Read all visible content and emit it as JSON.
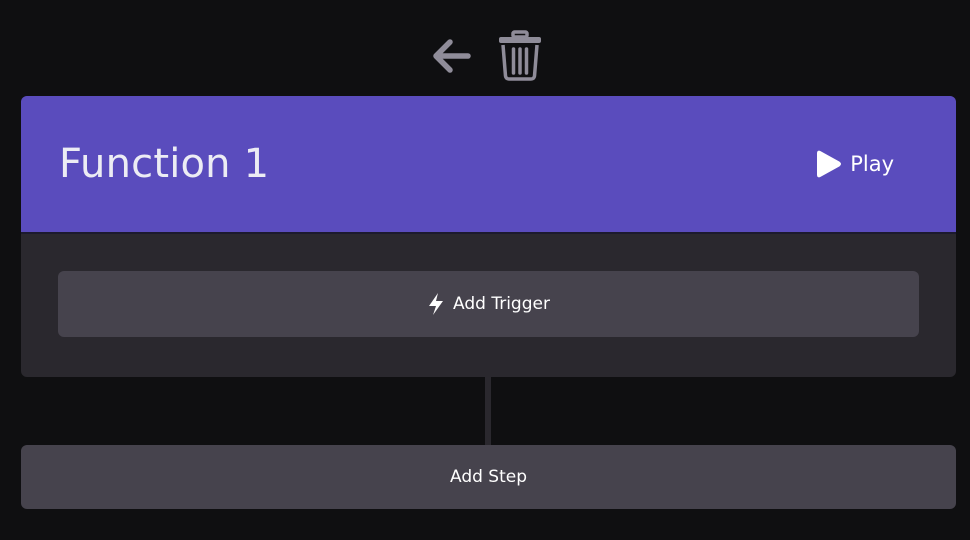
{
  "toolbar": {
    "back_icon": "arrow-left-icon",
    "delete_icon": "trash-icon"
  },
  "function_card": {
    "title": "Function 1",
    "play_label": "Play",
    "play_icon": "play-icon",
    "add_trigger_label": "Add Trigger",
    "trigger_icon": "lightning-bolt-icon"
  },
  "add_step_label": "Add Step",
  "colors": {
    "background": "#0f0f11",
    "header_accent": "#5a4cbd",
    "card_body": "#2a282e",
    "button_bg": "#46434d",
    "icon_gray": "#8f8c99"
  }
}
